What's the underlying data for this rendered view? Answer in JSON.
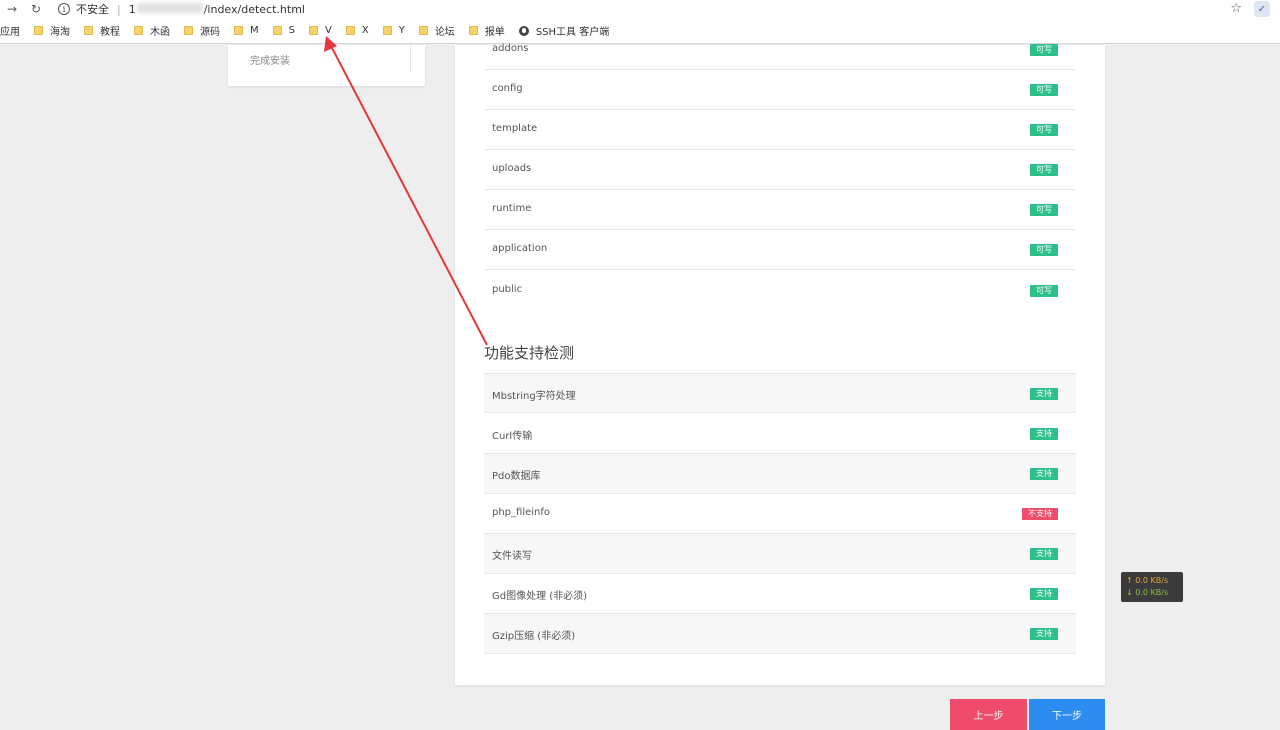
{
  "browser": {
    "insecure_label": "不安全",
    "url_host": "1",
    "url_path": "/index/detect.html"
  },
  "bookmarks": [
    {
      "label": "应用",
      "icon": "apps-icon"
    },
    {
      "label": "海淘",
      "icon": "folder-icon"
    },
    {
      "label": "教程",
      "icon": "folder-icon"
    },
    {
      "label": "木函",
      "icon": "folder-icon"
    },
    {
      "label": "源码",
      "icon": "folder-icon"
    },
    {
      "label": "M",
      "icon": "folder-icon"
    },
    {
      "label": "S",
      "icon": "folder-icon"
    },
    {
      "label": "V",
      "icon": "folder-icon"
    },
    {
      "label": "X",
      "icon": "folder-icon"
    },
    {
      "label": "Y",
      "icon": "folder-icon"
    },
    {
      "label": "论坛",
      "icon": "folder-icon"
    },
    {
      "label": "报单",
      "icon": "folder-icon"
    },
    {
      "label": "SSH工具 客户端",
      "icon": "globe-icon"
    }
  ],
  "steps": {
    "finish_label": "完成安装"
  },
  "dirs": [
    {
      "name": "addons",
      "status": "可写"
    },
    {
      "name": "config",
      "status": "可写"
    },
    {
      "name": "template",
      "status": "可写"
    },
    {
      "name": "uploads",
      "status": "可写"
    },
    {
      "name": "runtime",
      "status": "可写"
    },
    {
      "name": "application",
      "status": "可写"
    },
    {
      "name": "public",
      "status": "可写"
    }
  ],
  "functions": {
    "title": "功能支持检测",
    "items": [
      {
        "name": "Mbstring字符处理",
        "status": "支持",
        "ok": true
      },
      {
        "name": "Curl传输",
        "status": "支持",
        "ok": true
      },
      {
        "name": "Pdo数据库",
        "status": "支持",
        "ok": true
      },
      {
        "name": "php_fileinfo",
        "status": "不支持",
        "ok": false
      },
      {
        "name": "文件读写",
        "status": "支持",
        "ok": true
      },
      {
        "name": "Gd图像处理 (非必须)",
        "status": "支持",
        "ok": true
      },
      {
        "name": "Gzip压缩 (非必须)",
        "status": "支持",
        "ok": true
      }
    ]
  },
  "buttons": {
    "prev": "上一步",
    "next": "下一步"
  },
  "speed": {
    "up": "↑ 0.0 KB/s",
    "down": "↓ 0.0 KB/s"
  },
  "colors": {
    "ok": "#2ec08b",
    "bad": "#ef4b6a",
    "next": "#2d8cf0",
    "annotation": "#e8353b"
  }
}
